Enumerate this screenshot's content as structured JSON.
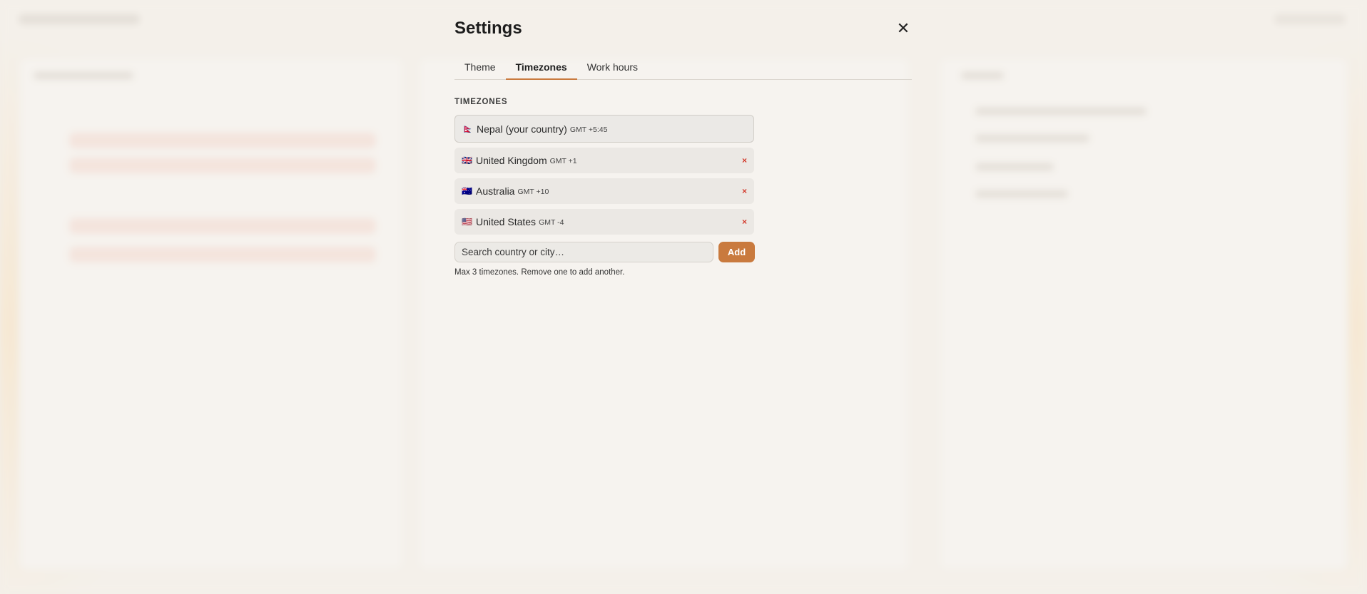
{
  "modal": {
    "title": "Settings",
    "close_label": "✕",
    "tabs": [
      {
        "label": "Theme",
        "active": false
      },
      {
        "label": "Timezones",
        "active": true
      },
      {
        "label": "Work hours",
        "active": false
      }
    ],
    "section_label": "TIMEZONES",
    "timezones": [
      {
        "flag": "🇳🇵",
        "name": "Nepal (your country)",
        "gmt": "GMT +5:45",
        "removable": false
      },
      {
        "flag": "🇬🇧",
        "name": "United Kingdom",
        "gmt": "GMT +1",
        "removable": true
      },
      {
        "flag": "🇦🇺",
        "name": "Australia",
        "gmt": "GMT +10",
        "removable": true
      },
      {
        "flag": "🇺🇸",
        "name": "United States",
        "gmt": "GMT -4",
        "removable": true
      }
    ],
    "remove_label": "×",
    "search": {
      "placeholder": "Search country or city…",
      "value": ""
    },
    "add_label": "Add",
    "hint": "Max 3 timezones. Remove one to add another."
  },
  "colors": {
    "accent": "#c97a3e",
    "remove": "#d33a2c",
    "row_bg": "#ebe8e4"
  }
}
